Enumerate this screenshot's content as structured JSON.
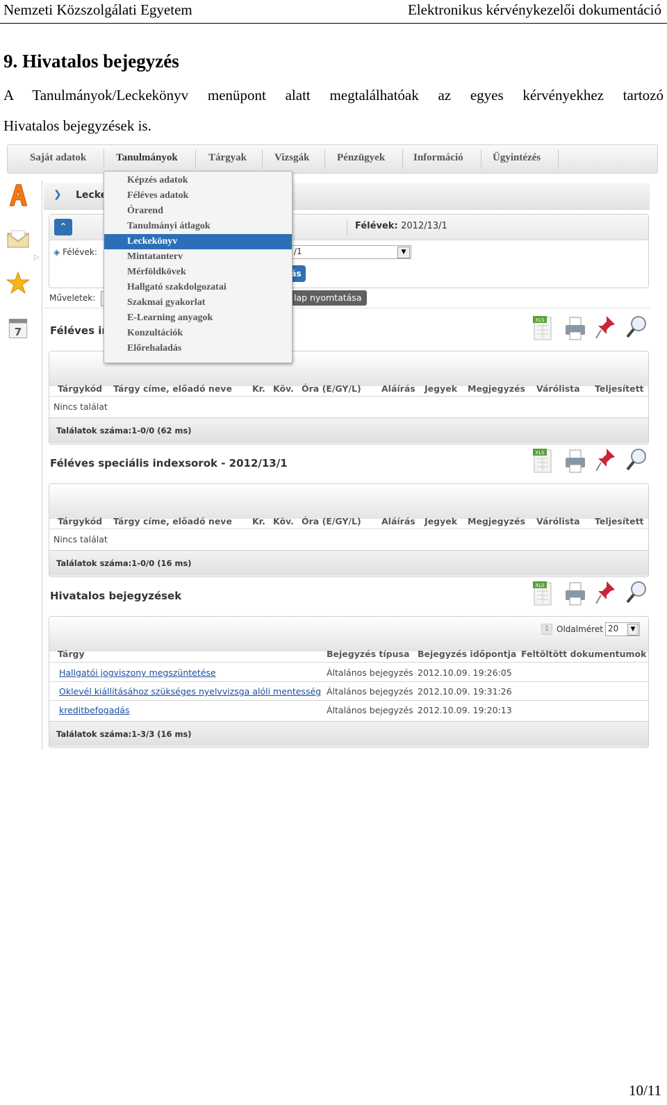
{
  "header": {
    "left": "Nemzeti Közszolgálati Egyetem",
    "right": "Elektronikus kérvénykezelői dokumentáció"
  },
  "heading": "9. Hivatalos bejegyzés",
  "paragraph_line1": "A Tanulmányok/Leckekönyv menüpont alatt megtalálhatóak az egyes kérvényekhez tartozó",
  "paragraph_line2": "Hivatalos bejegyzések is.",
  "page_number": "10/11",
  "screenshot": {
    "nav": [
      "Saját adatok",
      "Tanulmányok",
      "Tárgyak",
      "Vizsgák",
      "Pénzügyek",
      "Információ",
      "Ügyintézés"
    ],
    "crumb": "Lecke",
    "felevek_label": "Félévek:",
    "felevek_value": "2012/13/1",
    "felevek_field_label": "Félévek:",
    "felevek_field_value": "/1",
    "btn_partial": "ás",
    "muveletek_label": "Műveletek:",
    "print_action": "lap nyomtatása",
    "menu": [
      "Képzés adatok",
      "Féléves adatok",
      "Órarend",
      "Tanulmányi átlagok",
      "Leckekönyv",
      "Mintatanterv",
      "Mérföldkövek",
      "Hallgató szakdolgozatai",
      "Szakmai gyakorlat",
      "E-Learning anyagok",
      "Konzultációk",
      "Előrehaladás"
    ],
    "section1_title": "Féléves in",
    "section2_title": "Féléves speciális indexsorok - 2012/13/1",
    "section3_title": "Hivatalos bejegyzések",
    "cols": [
      "Tárgykód",
      "Tárgy címe, előadó neve",
      "Kr.",
      "Köv.",
      "Óra (E/GY/L)",
      "Aláírás",
      "Jegyek",
      "Megjegyzés",
      "Várólista",
      "Teljesített"
    ],
    "no_result": "Nincs találat",
    "footer1": "Találatok száma:1-0/0 (62 ms)",
    "footer2": "Találatok száma:1-0/0 (16 ms)",
    "pager_page": "1",
    "pager_label": "Oldalméret",
    "pager_size": "20",
    "cols3": [
      "Tárgy",
      "Bejegyzés típusa",
      "Bejegyzés időpontja",
      "Feltöltött dokumentumok"
    ],
    "rows3": [
      {
        "subject": "Hallgatói jogviszony megszüntetése",
        "type": "Általános bejegyzés",
        "time": "2012.10.09. 19:26:05"
      },
      {
        "subject": "Oklevél kiállításához szükséges nyelvvizsga alóli mentesség",
        "type": "Általános bejegyzés",
        "time": "2012.10.09. 19:31:26"
      },
      {
        "subject": "kreditbefogadás",
        "type": "Általános bejegyzés",
        "time": "2012.10.09. 19:20:13"
      }
    ],
    "footer3": "Találatok száma:1-3/3 (16 ms)",
    "xls_label": "XLS"
  }
}
